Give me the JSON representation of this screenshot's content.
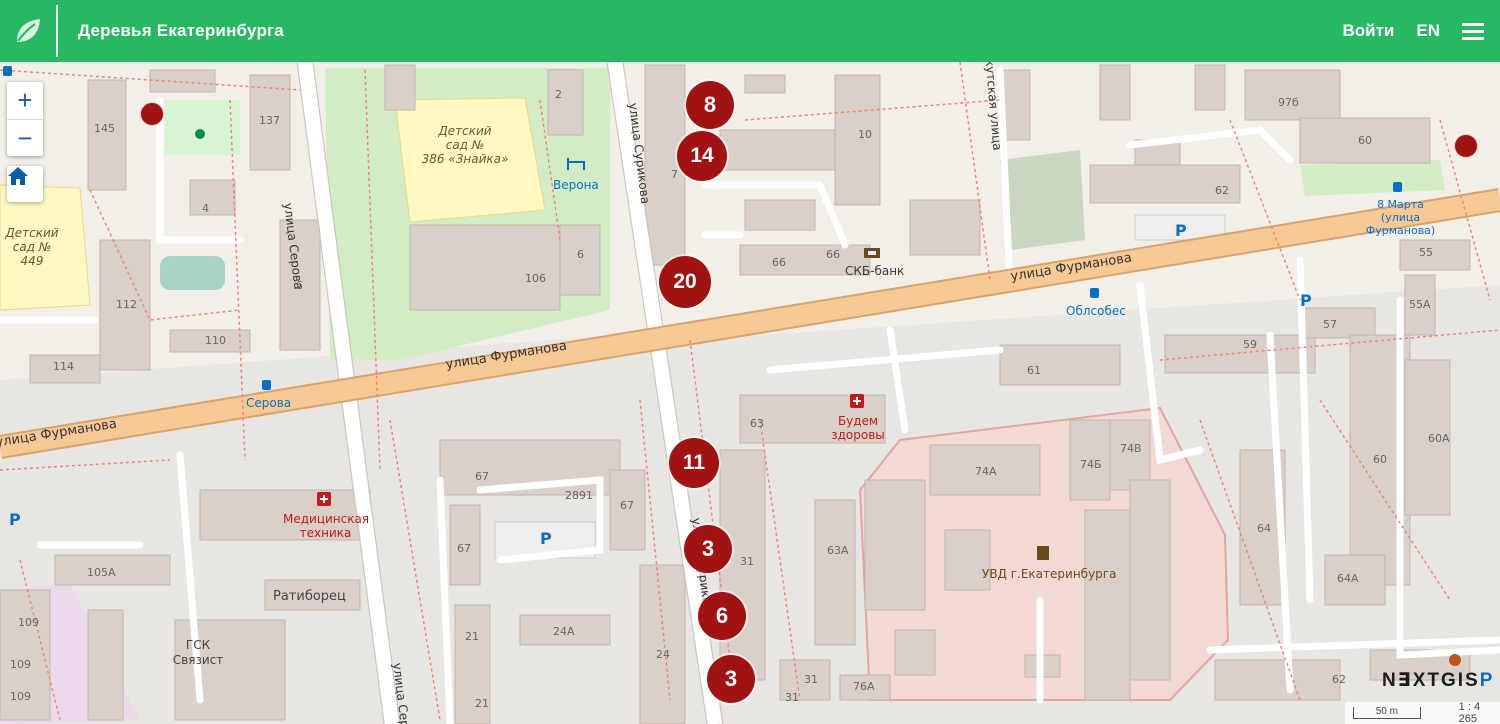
{
  "header": {
    "title": "Деревья Екатеринбурга",
    "login_label": "Войти",
    "lang_label": "EN"
  },
  "map": {
    "streets": {
      "furmanova_left": "улица Фурманова",
      "furmanova_mid": "улица Фурманова",
      "furmanova_right": "улица Фурманова",
      "serova_top": "улица Серова",
      "serova_bottom": "улица Серова",
      "surikova_top": "улица Сурикова",
      "surikova_bottom": "улица Сурикова",
      "irkutskaya": "Иркутская улица"
    },
    "pois": {
      "kindergarten_386": [
        "Детский",
        "сад №",
        "386 «Знайка»"
      ],
      "kindergarten_449": [
        "Детский",
        "сад №",
        "449"
      ],
      "verona": "Верона",
      "skb": "СКБ-банк",
      "serova_stop": "Серова",
      "oblsobes": "Облсобес",
      "march8": [
        "8 Марта",
        "(улица",
        "Фурманова)"
      ],
      "budem": [
        "Будем",
        "здоровы"
      ],
      "medtech": [
        "Медицинская",
        "техника"
      ],
      "ratiborets": "Ратиборец",
      "gsk": [
        "ГСК",
        "Связист"
      ],
      "uvd": "УВД г.Екатеринбурга"
    },
    "house_numbers": [
      "145",
      "137",
      "2",
      "10",
      "97б",
      "60",
      "62",
      "4",
      "106",
      "6",
      "66",
      "66",
      "112",
      "6",
      "110",
      "114",
      "59",
      "57",
      "55",
      "55А",
      "61",
      "63",
      "74А",
      "74Б",
      "74В",
      "67",
      "2891",
      "67",
      "63А",
      "60А",
      "60",
      "64",
      "64А",
      "105А",
      "109",
      "109",
      "109",
      "21",
      "24А",
      "24",
      "21",
      "31",
      "31",
      "31",
      "76А",
      "62",
      "7",
      "67"
    ],
    "clusters": [
      {
        "count": "8"
      },
      {
        "count": "14"
      },
      {
        "count": "20"
      },
      {
        "count": "11"
      },
      {
        "count": "3"
      },
      {
        "count": "6"
      },
      {
        "count": "3"
      }
    ],
    "single_markers": 3
  },
  "controls": {
    "zoom_in": "+",
    "zoom_out": "−"
  },
  "attribution": {
    "brand_left": "N∃XTGIS",
    "brand_right": "P",
    "scale_text": "50 m",
    "scale_ratio": "1 : 4 265"
  },
  "colors": {
    "header": "#27b962",
    "cluster": "#a11212",
    "major_road": "#f7c995",
    "zoom_icon": "#1a5ea8"
  },
  "icons": {
    "logo": "leaf-icon",
    "menu": "hamburger-icon",
    "home": "home-icon"
  }
}
